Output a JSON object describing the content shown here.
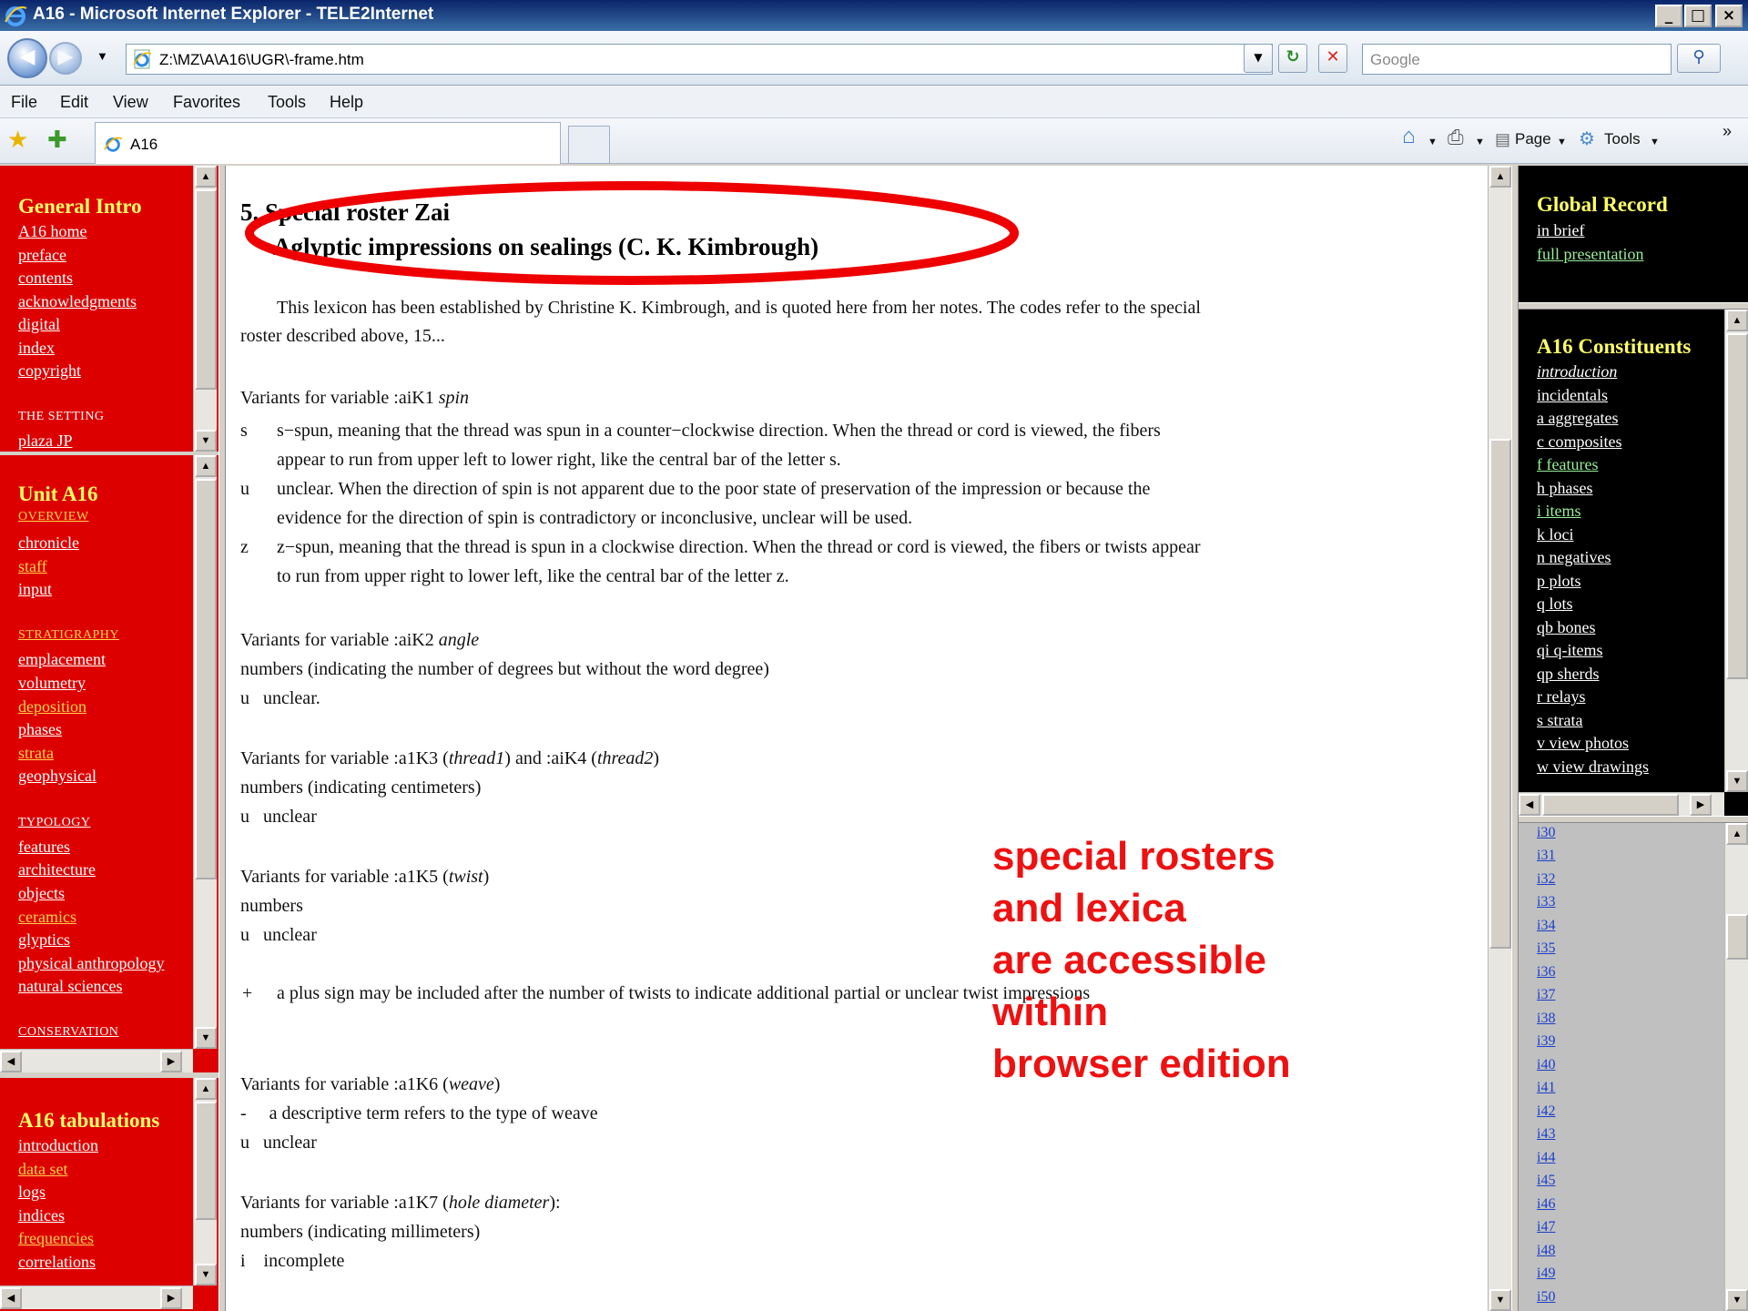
{
  "window": {
    "title": "A16 - Microsoft Internet Explorer - TELE2Internet"
  },
  "addressbar": {
    "url": "Z:\\MZ\\A\\A16\\UGR\\-frame.htm",
    "search_placeholder": "Google"
  },
  "menu": [
    "File",
    "Edit",
    "View",
    "Favorites",
    "Tools",
    "Help"
  ],
  "tab": {
    "label": "A16"
  },
  "commandbar": {
    "page": "Page",
    "tools": "Tools"
  },
  "left_frame_1": {
    "title": "General Intro",
    "links": [
      "A16 home",
      "preface",
      "contents",
      "acknowledgments",
      "digital",
      "index",
      "copyright"
    ],
    "section": "The Setting",
    "section_link": "plaza JP"
  },
  "left_frame_2": {
    "title": "Unit A16",
    "overview": "Overview",
    "links_a": [
      "chronicle",
      "staff",
      "input"
    ],
    "stratigraphy": "Stratigraphy",
    "links_b": [
      "emplacement",
      "volumetry",
      "deposition",
      "phases",
      "strata",
      "geophysical"
    ],
    "typology": "Typology",
    "links_c": [
      "features",
      "architecture",
      "objects",
      "ceramics",
      "glyptics",
      "physical anthropology",
      "natural sciences"
    ],
    "conservation": "Conservation"
  },
  "left_frame_3": {
    "title": "A16 tabulations",
    "links": [
      "introduction",
      "data set",
      "logs",
      "indices",
      "frequencies",
      "correlations"
    ]
  },
  "right_frame_1": {
    "title": "Global Record",
    "links": [
      "in brief",
      "full presentation"
    ]
  },
  "right_frame_2": {
    "title": "A16 Constituents",
    "links": [
      "introduction",
      "incidentals",
      "a aggregates",
      "c composites",
      "f features",
      "h phases",
      "i items",
      "k loci",
      "n negatives",
      "p plots",
      "q lots",
      "qb bones",
      "qi q-items",
      "qp sherds",
      "r relays",
      "s strata",
      "v view photos",
      "w view drawings"
    ]
  },
  "right_frame_3": {
    "items": [
      "i30",
      "i31",
      "i32",
      "i33",
      "i34",
      "i35",
      "i36",
      "i37",
      "i38",
      "i39",
      "i40",
      "i41",
      "i42",
      "i43",
      "i44",
      "i45",
      "i46",
      "i47",
      "i48",
      "i49",
      "i50"
    ]
  },
  "main": {
    "heading1": "5. Special roster Zai",
    "heading2": "Aglyptic impressions on sealings (C. K. Kimbrough)",
    "intro1": "This lexicon has been established by Christine K. Kimbrough, and is quoted here from her notes. The codes refer to the special",
    "intro2": "roster described above, 15...",
    "k1_label": "Variants for variable :aiK1 ",
    "k1_var": "spin",
    "s_key": "s",
    "s_line1": "s−spun, meaning that the thread was spun in a counter−clockwise direction. When the thread or cord is viewed, the fibers",
    "s_line2": "appear to run from upper left to lower right, like the central bar of the letter s.",
    "u_key": "u",
    "u_line1": "unclear. When the direction of spin is not apparent due to the poor state of preservation of the impression or because the",
    "u_line2": "evidence for the direction of spin is contradictory or inconclusive, unclear will be used.",
    "z_key": "z",
    "z_line1": "z−spun, meaning that the thread is spun in a clockwise direction.  When the thread or cord is viewed, the fibers or twists appear",
    "z_line2": "to run from upper right to lower left, like the central bar of the letter z.",
    "k2_label": "Variants for variable :aiK2 ",
    "k2_var": "angle",
    "k2_numbers": "numbers (indicating the number of degrees but without the word degree)",
    "k2_u": "u   unclear.",
    "k3_label_a": "Variants for variable :a1K3 (",
    "k3_var1": "thread1",
    "k3_label_b": ") and :aiK4 (",
    "k3_var2": "thread2",
    "k3_label_c": ")",
    "k3_numbers": "numbers (indicating centimeters)",
    "k3_u": "u   unclear",
    "k5_label_a": "Variants for variable :a1K5 (",
    "k5_var": "twist",
    "k5_label_b": ")",
    "k5_numbers": "numbers",
    "k5_u": "u   unclear",
    "plus_key": "+",
    "plus_text": "a plus sign may be included after the number of twists to indicate additional partial or unclear twist impressions",
    "k6_label_a": "Variants for variable :a1K6 (",
    "k6_var": "weave",
    "k6_label_b": ")",
    "k6_dash": "-     a descriptive term refers to the type of weave",
    "k6_u": "u   unclear",
    "k7_label_a": "Variants for variable :a1K7 (",
    "k7_var": "hole diameter",
    "k7_label_b": "):",
    "k7_numbers": "numbers (indicating millimeters)",
    "k7_i": "i    incomplete"
  },
  "callout": [
    "special rosters",
    "and lexica",
    "are accessible",
    "within",
    "browser edition"
  ],
  "colors": {
    "left_frames": "#dd0000",
    "right_frames": "#000000",
    "callout": "#ee1111",
    "highlight_ellipse": "#ee0000"
  }
}
